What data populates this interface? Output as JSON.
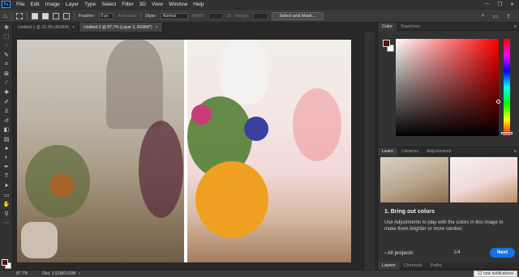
{
  "app": {
    "logo": "Ps"
  },
  "menu": [
    "File",
    "Edit",
    "Image",
    "Layer",
    "Type",
    "Select",
    "Filter",
    "3D",
    "View",
    "Window",
    "Help"
  ],
  "window_controls": [
    "—",
    "❐",
    "✕"
  ],
  "options": {
    "feather_label": "Feather:",
    "feather_value": "0 px",
    "antialias_label": "Anti-alias",
    "style_label": "Style:",
    "style_value": "Normal",
    "width_label": "Width:",
    "height_label": "Height:",
    "select_mask_button": "Select and Mask..."
  },
  "tabs": [
    {
      "label": "Untitled-1 @ 33.3% (RGB/8)",
      "active": false,
      "close": "×"
    },
    {
      "label": "Untitled-2 @ 87.7% (Layer 2, RGB/8*)",
      "active": true,
      "close": "×"
    }
  ],
  "color_panel": {
    "tabs": [
      "Color",
      "Swatches"
    ],
    "foreground": "#5a1010",
    "background": "#ffffff"
  },
  "learn_panel": {
    "tabs": [
      "Learn",
      "Libraries",
      "Adjustments"
    ],
    "step_title": "1.  Bring out colors",
    "description": "Use Adjustments to play with the colors in this image to make them brighter or more somber.",
    "all_projects": "All projects",
    "page": "1/4",
    "next_button": "Next"
  },
  "layers_panel": {
    "tabs": [
      "Layers",
      "Channels",
      "Paths"
    ]
  },
  "status": {
    "zoom": "87.7%",
    "doc": "Doc: 1.91M/3.62M",
    "notification": "12 new notifications"
  },
  "colors": {
    "accent": "#1473e6",
    "panel": "#323232",
    "canvas_bg": "#282828"
  }
}
